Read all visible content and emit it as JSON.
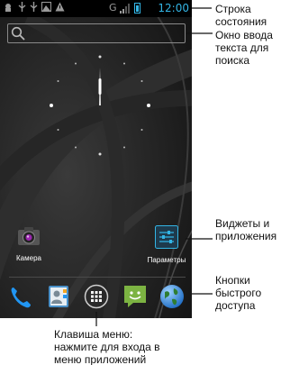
{
  "status_bar": {
    "time": "12:00",
    "network": "G",
    "icons": [
      "android-debug-icon",
      "usb-icon",
      "usb-icon",
      "image-icon",
      "warning-icon",
      "signal-icon",
      "battery-icon"
    ]
  },
  "search": {
    "icon": "search-icon"
  },
  "clock": {
    "type": "analog-clock"
  },
  "apps": [
    {
      "label": "Камера",
      "icon": "camera-icon"
    },
    {
      "label": "Параметры",
      "icon": "settings-icon"
    }
  ],
  "dock": [
    {
      "icon": "phone-icon"
    },
    {
      "icon": "contacts-icon"
    },
    {
      "icon": "app-drawer-icon"
    },
    {
      "icon": "messaging-icon"
    },
    {
      "icon": "browser-globe-icon"
    }
  ],
  "annotations": {
    "status_bar": [
      "Строка",
      "состояния"
    ],
    "search": [
      "Окно ввода",
      "текста для",
      "поиска"
    ],
    "widgets": [
      "Виджеты и",
      "приложения"
    ],
    "quick": [
      "Кнопки",
      "быстрого",
      "доступа"
    ],
    "menu": [
      "Клавиша меню:",
      "нажмите для входа в",
      "меню приложений"
    ]
  },
  "colors": {
    "accent": "#33b5e5",
    "background": "#1c1c1c",
    "text_annotation": "#111111"
  }
}
